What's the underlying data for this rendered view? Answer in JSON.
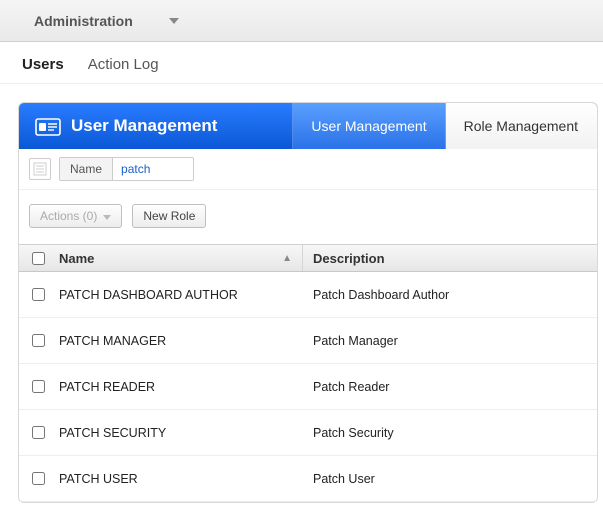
{
  "topmenu": {
    "label": "Administration"
  },
  "tabs": {
    "users": "Users",
    "actionlog": "Action Log",
    "active": "users"
  },
  "panel": {
    "title": "User Management",
    "subtabs": {
      "usermgmt": "User Management",
      "rolemgmt": "Role Management"
    }
  },
  "filter": {
    "label": "Name",
    "value": "patch"
  },
  "toolbar": {
    "actions_label": "Actions (0)",
    "newrole_label": "New Role"
  },
  "grid": {
    "headers": {
      "name": "Name",
      "description": "Description"
    },
    "rows": [
      {
        "name": "PATCH DASHBOARD AUTHOR",
        "description": "Patch Dashboard Author"
      },
      {
        "name": "PATCH MANAGER",
        "description": "Patch Manager"
      },
      {
        "name": "PATCH READER",
        "description": "Patch Reader"
      },
      {
        "name": "PATCH SECURITY",
        "description": "Patch Security"
      },
      {
        "name": "PATCH USER",
        "description": "Patch User"
      }
    ]
  }
}
